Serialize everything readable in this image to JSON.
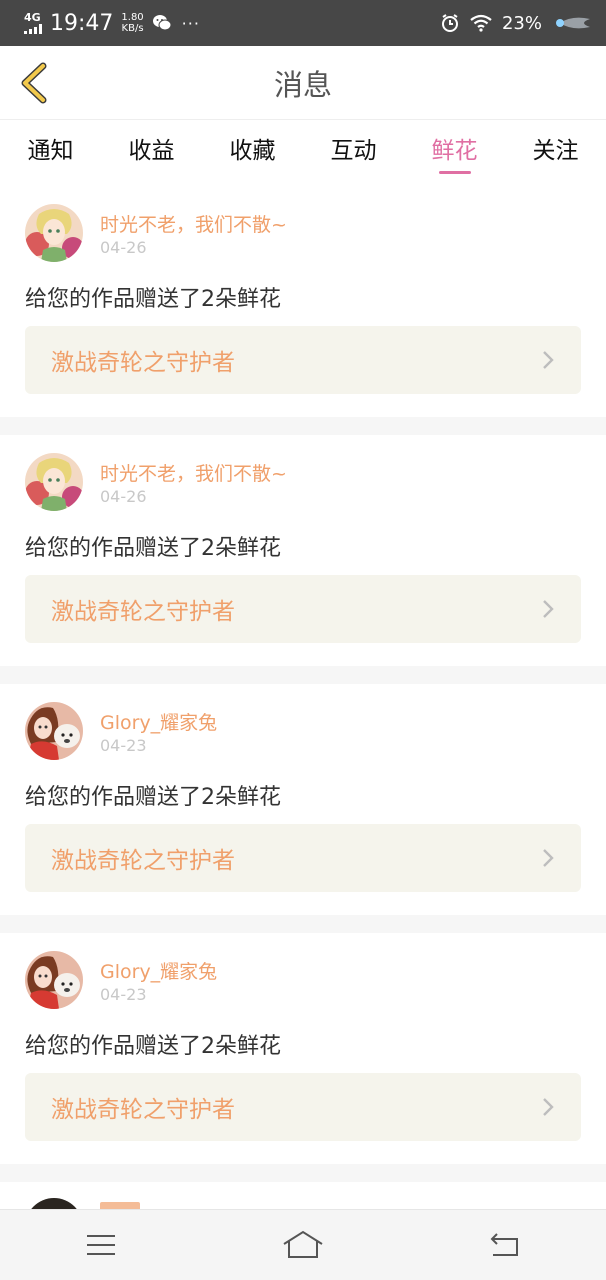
{
  "status_bar": {
    "network": "4G",
    "time": "19:47",
    "speed_value": "1.80",
    "speed_unit": "KB/s",
    "more": "···",
    "battery": "23%",
    "icons": [
      "signal-icon",
      "wechat-icon",
      "alarm-icon",
      "wifi-icon",
      "rocket-icon"
    ]
  },
  "header": {
    "title": "消息",
    "back_icon": "chevron-left-icon",
    "accent_color": "#f2c94c"
  },
  "tabs": [
    {
      "label": "通知",
      "active": false
    },
    {
      "label": "收益",
      "active": false
    },
    {
      "label": "收藏",
      "active": false
    },
    {
      "label": "互动",
      "active": false
    },
    {
      "label": "鲜花",
      "active": true
    },
    {
      "label": "关注",
      "active": false
    }
  ],
  "colors": {
    "active_tab": "#e06fa3",
    "name": "#f0a06b",
    "card_bg": "#f5f4ec"
  },
  "messages": [
    {
      "sender": "时光不老，我们不散~",
      "date": "04-26",
      "text": "给您的作品赠送了2朵鲜花",
      "work": "激战奇轮之守护者",
      "avatar": "anime-girl-avatar"
    },
    {
      "sender": "时光不老，我们不散~",
      "date": "04-26",
      "text": "给您的作品赠送了2朵鲜花",
      "work": "激战奇轮之守护者",
      "avatar": "anime-girl-avatar"
    },
    {
      "sender": "Glory_耀家兔",
      "date": "04-23",
      "text": "给您的作品赠送了2朵鲜花",
      "work": "激战奇轮之守护者",
      "avatar": "girl-with-dog-avatar"
    },
    {
      "sender": "Glory_耀家兔",
      "date": "04-23",
      "text": "给您的作品赠送了2朵鲜花",
      "work": "激战奇轮之守护者",
      "avatar": "girl-with-dog-avatar"
    }
  ],
  "nav_bar": {
    "icons": [
      "menu-icon",
      "home-icon",
      "back-icon"
    ]
  }
}
